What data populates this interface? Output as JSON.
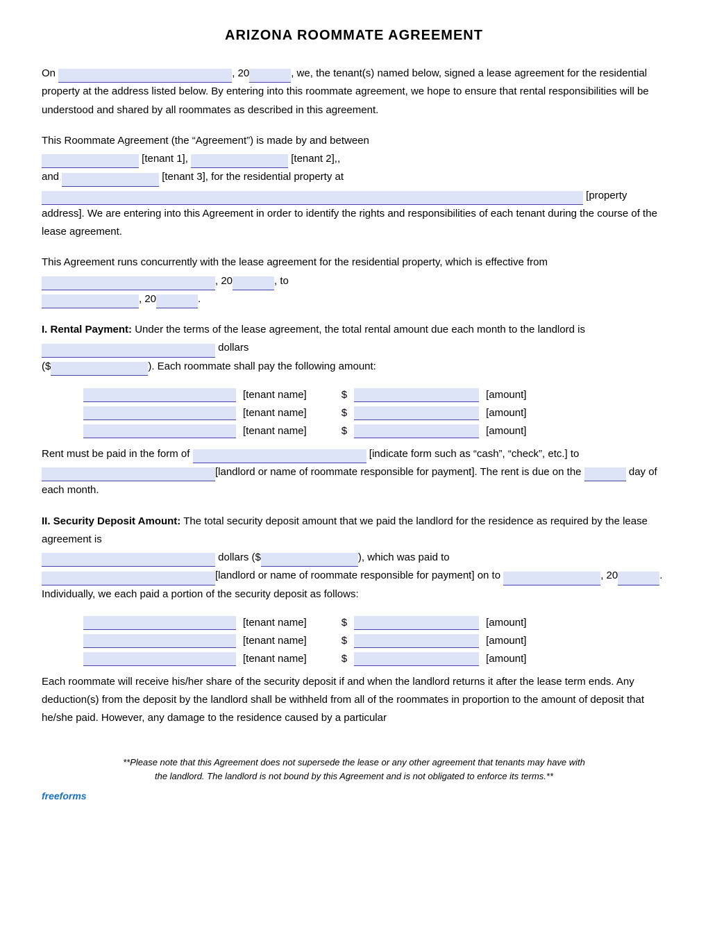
{
  "title": "ARIZONA ROOMMATE AGREEMENT",
  "intro": {
    "line1_pre": "On",
    "line1_mid": ", 20",
    "line1_post": ", we, the tenant(s) named below, signed a lease agreement for the residential property at the address listed below. By entering into this roommate agreement, we hope to ensure that rental responsibilities will be understood and shared by all roommates as described in this agreement."
  },
  "parties": {
    "pre": "This Roommate Agreement (the “Agreement”) is made by and between",
    "tenant1_label": "[tenant 1],",
    "tenant2_label": "[tenant 2],,",
    "and_label": "and",
    "tenant3_label": "[tenant 3], for the residential property at",
    "property_label": "[property address]. We are entering into this Agreement in order to identify the rights and responsibilities of each tenant during the course of the lease agreement."
  },
  "runs": {
    "pre": "This Agreement runs concurrently with the lease agreement for the residential property, which is effective from",
    "mid1": ", 20",
    "to_label": "to",
    "mid2": ", 20"
  },
  "section1": {
    "heading": "I.  Rental Payment:",
    "text1": "Under the terms of the lease agreement, the total rental amount due each month to the landlord is",
    "text2": "dollars",
    "text3": "($",
    "text4": "). Each roommate shall pay the following amount:",
    "tenants": [
      {
        "label": "[tenant name]",
        "amount_label": "[amount]"
      },
      {
        "label": "[tenant name]",
        "amount_label": "[amount]"
      },
      {
        "label": "[tenant name]",
        "amount_label": "[amount]"
      }
    ],
    "rent_form_pre": "Rent must be paid in the form of",
    "rent_form_mid": "[indicate form such as “cash”, “check”, etc.] to",
    "rent_form_post": "[landlord or name of roommate responsible for payment]. The rent is due on the",
    "rent_form_end": "day of each month."
  },
  "section2": {
    "heading": "II.  Security Deposit Amount:",
    "text1": "The total security deposit amount that we paid the landlord for the residence as required by the lease agreement is",
    "text2": "dollars ($",
    "text3": "), which was paid to",
    "text4": "[landlord or name of roommate responsible for payment] on to",
    "text5": ", 20",
    "text6": ". Individually, we each paid a portion of the security deposit as follows:",
    "tenants": [
      {
        "label": "[tenant name]",
        "amount_label": "[amount]"
      },
      {
        "label": "[tenant name]",
        "amount_label": "[amount]"
      },
      {
        "label": "[tenant name]",
        "amount_label": "[amount]"
      }
    ]
  },
  "closing_para": "Each roommate will receive his/her share of the security deposit if and when the landlord returns it after the lease term ends. Any deduction(s) from the deposit by the landlord shall be withheld from all of the roommates in proportion to the amount of deposit that he/she paid. However, any damage to the residence caused by a particular",
  "footnote": {
    "line1": "**Please note that this Agreement does not supersede the lease or any other agreement that tenants may have with",
    "line2": "the landlord. The landlord is not bound by this Agreement and is not obligated to enforce its terms.**",
    "brand": "freeforms"
  }
}
